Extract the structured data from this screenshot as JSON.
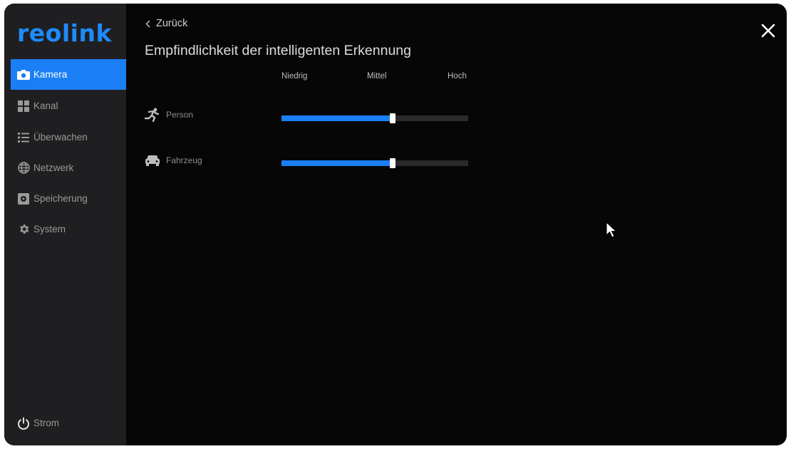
{
  "sidebar": {
    "logo": "reolink",
    "items": [
      {
        "label": "Kamera",
        "icon": "camera-icon",
        "active": true
      },
      {
        "label": "Kanal",
        "icon": "grid-icon",
        "active": false
      },
      {
        "label": "Überwachen",
        "icon": "list-icon",
        "active": false
      },
      {
        "label": "Netzwerk",
        "icon": "globe-icon",
        "active": false
      },
      {
        "label": "Speicherung",
        "icon": "storage-icon",
        "active": false
      },
      {
        "label": "System",
        "icon": "gear-icon",
        "active": false
      }
    ],
    "power": {
      "label": "Strom",
      "icon": "power-icon"
    }
  },
  "header": {
    "back_label": "Zurück",
    "title": "Empfindlichkeit der intelligenten Erkennung",
    "close_icon": "close-icon"
  },
  "scale": {
    "low": "Niedrig",
    "mid": "Mittel",
    "high": "Hoch"
  },
  "sensitivity": [
    {
      "label": "Person",
      "icon": "person-running-icon",
      "value_fraction": 0.595
    },
    {
      "label": "Fahrzeug",
      "icon": "car-icon",
      "value_fraction": 0.595
    }
  ],
  "colors": {
    "accent": "#1a7ff5",
    "sidebar_bg": "#1f1f21",
    "main_bg": "#060606"
  }
}
